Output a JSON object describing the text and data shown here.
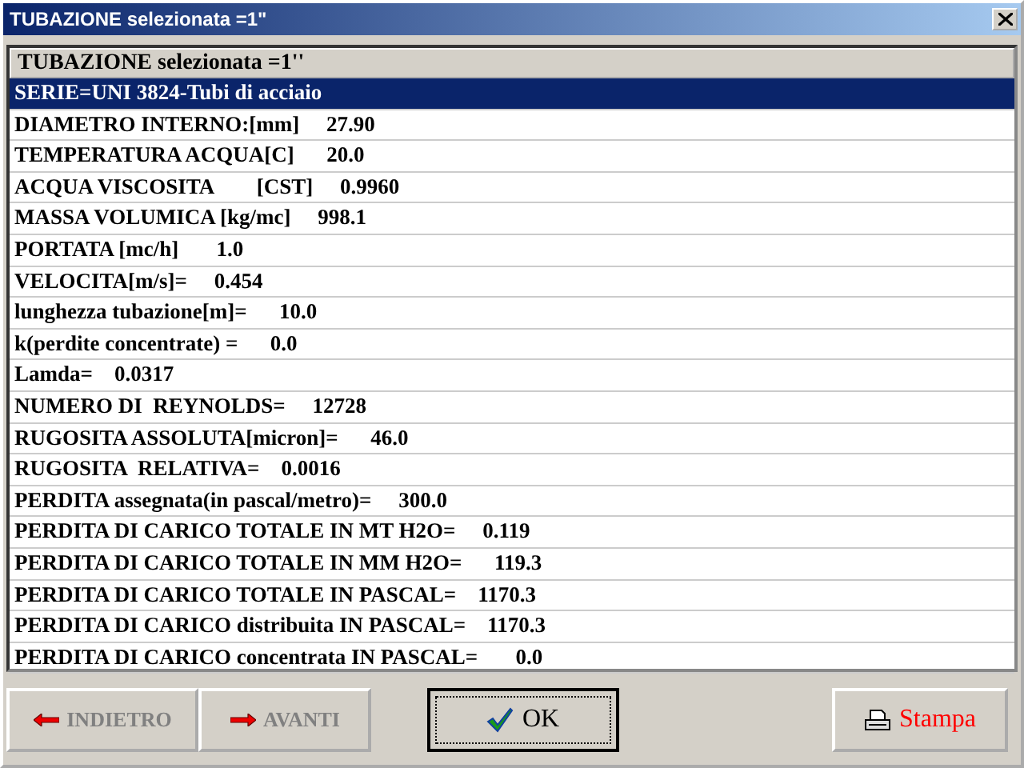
{
  "window": {
    "title": "TUBAZIONE selezionata =1\""
  },
  "list": {
    "header": "TUBAZIONE selezionata =1''",
    "rows": [
      {
        "text": "SERIE=UNI 3824-Tubi di acciaio",
        "selected": true
      },
      {
        "text": "DIAMETRO INTERNO:[mm]     27.90",
        "selected": false
      },
      {
        "text": "TEMPERATURA ACQUA[C]      20.0",
        "selected": false
      },
      {
        "text": "ACQUA VISCOSITA        [CST]     0.9960",
        "selected": false
      },
      {
        "text": "MASSA VOLUMICA [kg/mc]     998.1",
        "selected": false
      },
      {
        "text": "PORTATA [mc/h]       1.0",
        "selected": false
      },
      {
        "text": "VELOCITA[m/s]=     0.454",
        "selected": false
      },
      {
        "text": "lunghezza tubazione[m]=      10.0",
        "selected": false
      },
      {
        "text": "k(perdite concentrate) =      0.0",
        "selected": false
      },
      {
        "text": "Lamda=    0.0317",
        "selected": false
      },
      {
        "text": "NUMERO DI  REYNOLDS=     12728",
        "selected": false
      },
      {
        "text": "RUGOSITA ASSOLUTA[micron]=      46.0",
        "selected": false
      },
      {
        "text": "RUGOSITA  RELATIVA=    0.0016",
        "selected": false
      },
      {
        "text": "PERDITA assegnata(in pascal/metro)=     300.0",
        "selected": false
      },
      {
        "text": "PERDITA DI CARICO TOTALE IN MT H2O=     0.119",
        "selected": false
      },
      {
        "text": "PERDITA DI CARICO TOTALE IN MM H2O=      119.3",
        "selected": false
      },
      {
        "text": "PERDITA DI CARICO TOTALE IN PASCAL=    1170.3",
        "selected": false
      },
      {
        "text": "PERDITA DI CARICO distribuita IN PASCAL=    1170.3",
        "selected": false
      },
      {
        "text": "PERDITA DI CARICO concentrata IN PASCAL=       0.0",
        "selected": false
      }
    ]
  },
  "buttons": [
    {
      "label": "INDIETRO",
      "kind": "back",
      "disabled": true
    },
    {
      "label": "AVANTI",
      "kind": "forward",
      "disabled": true
    },
    {
      "label": "OK",
      "kind": "ok",
      "disabled": false
    },
    {
      "label": "Stampa",
      "kind": "print",
      "disabled": false
    }
  ]
}
